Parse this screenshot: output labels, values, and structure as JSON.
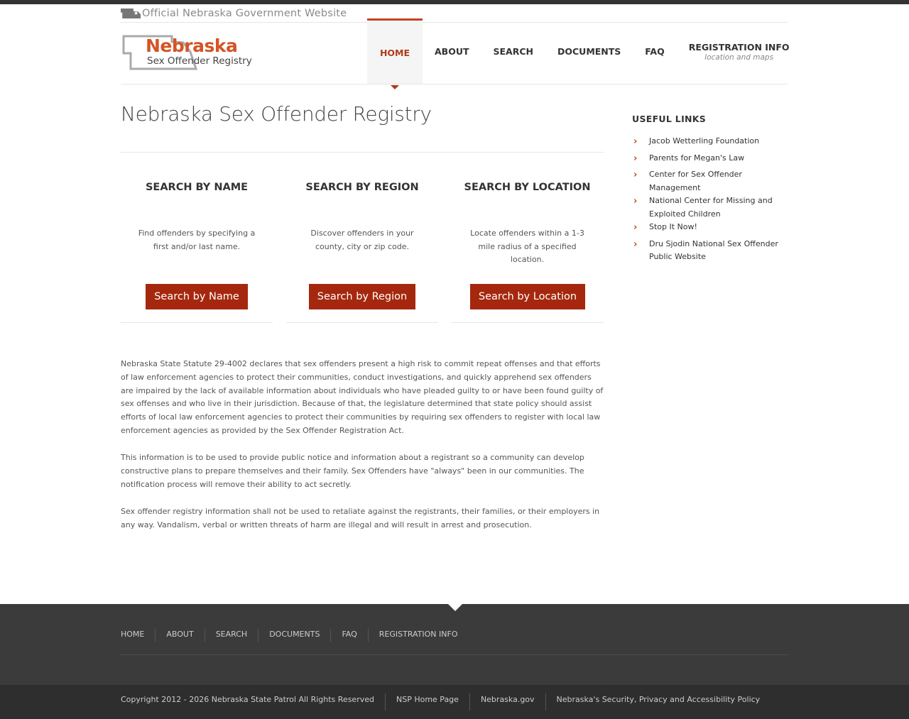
{
  "header": {
    "gov_label": "Official Nebraska Government Website",
    "logo_title": "Nebraska",
    "logo_subtitle": "Sex Offender Registry"
  },
  "nav": {
    "items": [
      {
        "label": "HOME",
        "sub": "",
        "active": true
      },
      {
        "label": "ABOUT",
        "sub": ""
      },
      {
        "label": "SEARCH",
        "sub": ""
      },
      {
        "label": "DOCUMENTS",
        "sub": ""
      },
      {
        "label": "FAQ",
        "sub": ""
      },
      {
        "label": "REGISTRATION INFO",
        "sub": "location and maps"
      }
    ]
  },
  "main": {
    "title": "Nebraska Sex Offender Registry",
    "search_columns": [
      {
        "heading": "SEARCH BY NAME",
        "description": "Find offenders by specifying a first and/or last name.",
        "button": "Search by Name"
      },
      {
        "heading": "SEARCH BY REGION",
        "description": "Discover offenders in your county, city or zip code.",
        "button": "Search by Region"
      },
      {
        "heading": "SEARCH BY LOCATION",
        "description": "Locate offenders within a 1-3 mile radius of a specified location.",
        "button": "Search by Location"
      }
    ],
    "paragraphs": [
      "Nebraska State Statute 29-4002 declares that sex offenders present a high risk to commit repeat offenses and that efforts of law enforcement agencies to protect their communities, conduct investigations, and quickly apprehend sex offenders are impaired by the lack of available information about individuals who have pleaded guilty to or have been found guilty of sex offenses and who live in their jurisdiction. Because of that, the legislature determined that state policy should assist efforts of local law enforcement agencies to protect their communities by requiring sex offenders to register with local law enforcement agencies as provided by the Sex Offender Registration Act.",
      "This information is to be used to provide public notice and information about a registrant so a community can develop constructive plans to prepare themselves and their family. Sex Offenders have \"always\" been in our communities. The notification process will remove their ability to act secretly.",
      "Sex offender registry information shall not be used to retaliate against the registrants, their families, or their employers in any way. Vandalism, verbal or written threats of harm are illegal and will result in arrest and prosecution."
    ]
  },
  "sidebar": {
    "title": "USEFUL LINKS",
    "links": [
      "Jacob Wetterling Foundation",
      "Parents for Megan's Law",
      "Center for Sex Offender Management",
      "National Center for Missing and Exploited Children",
      "Stop It Now!",
      "Dru Sjodin National Sex Offender Public Website"
    ]
  },
  "footer": {
    "nav": [
      "HOME",
      "ABOUT",
      "SEARCH",
      "DOCUMENTS",
      "FAQ",
      "REGISTRATION INFO"
    ],
    "copyright": "Copyright 2012 - 2026 Nebraska State Patrol All Rights Reserved",
    "links": [
      "NSP Home Page",
      "Nebraska.gov",
      "Nebraska's Security, Privacy and Accessibility Policy"
    ]
  },
  "colors": {
    "accent": "#a5280e",
    "logo_orange": "#d35427",
    "footer_bg": "#3b3b3b"
  }
}
